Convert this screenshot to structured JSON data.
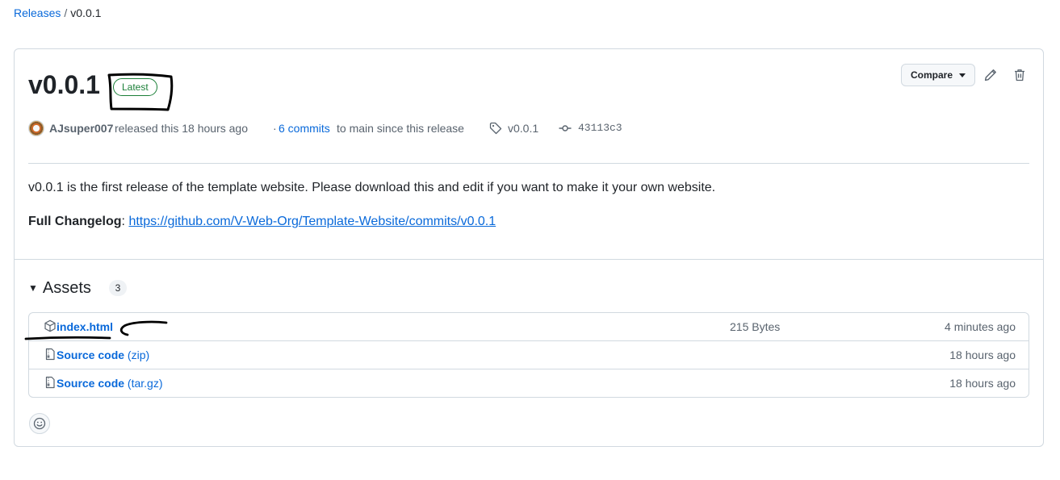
{
  "breadcrumb": {
    "releases_label": "Releases",
    "separator": "/",
    "current": "v0.0.1"
  },
  "release": {
    "title": "v0.0.1",
    "badge": "Latest",
    "compare_label": "Compare",
    "author": "AJsuper007",
    "released_text": "released this 18 hours ago",
    "commits_prefix": "·",
    "commits_link": "6 commits",
    "commits_suffix": "to main since this release",
    "tag": "v0.0.1",
    "commit_sha": "43113c3",
    "description": "v0.0.1 is the first release of the template website. Please download this and edit if you want to make it your own website.",
    "changelog_label": "Full Changelog",
    "changelog_colon": ":",
    "changelog_url": "https://github.com/V-Web-Org/Template-Website/commits/v0.0.1"
  },
  "assets": {
    "label": "Assets",
    "count": "3",
    "items": [
      {
        "icon": "package-icon",
        "name": "index.html",
        "ext": "",
        "size": "215 Bytes",
        "time": "4 minutes ago"
      },
      {
        "icon": "file-zip-icon",
        "name": "Source code",
        "ext": " (zip)",
        "size": "",
        "time": "18 hours ago"
      },
      {
        "icon": "file-zip-icon",
        "name": "Source code",
        "ext": " (tar.gz)",
        "size": "",
        "time": "18 hours ago"
      }
    ]
  },
  "colors": {
    "link": "#0969da",
    "latest_badge": "#1a7f37",
    "border": "#d1d9e0",
    "muted_text": "#59636e",
    "annotation_ink": "#000000"
  }
}
